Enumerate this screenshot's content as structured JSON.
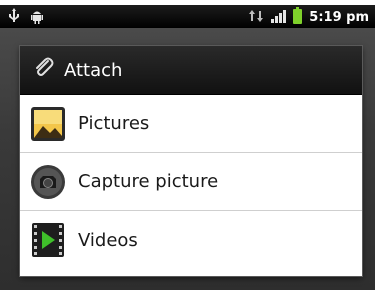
{
  "status_bar": {
    "time": "5:19 pm",
    "icons": [
      "usb-icon",
      "android-debug-icon",
      "data-transfer-icon",
      "signal-icon",
      "battery-icon"
    ]
  },
  "dialog": {
    "title": "Attach",
    "title_icon": "paperclip-icon",
    "items": [
      {
        "label": "Pictures",
        "icon": "gallery-icon"
      },
      {
        "label": "Capture picture",
        "icon": "camera-icon"
      },
      {
        "label": "Videos",
        "icon": "video-icon"
      }
    ]
  },
  "colors": {
    "header_bg": "#1a1a1a",
    "battery": "#7fd12b",
    "video_play": "#3fbf2a"
  }
}
